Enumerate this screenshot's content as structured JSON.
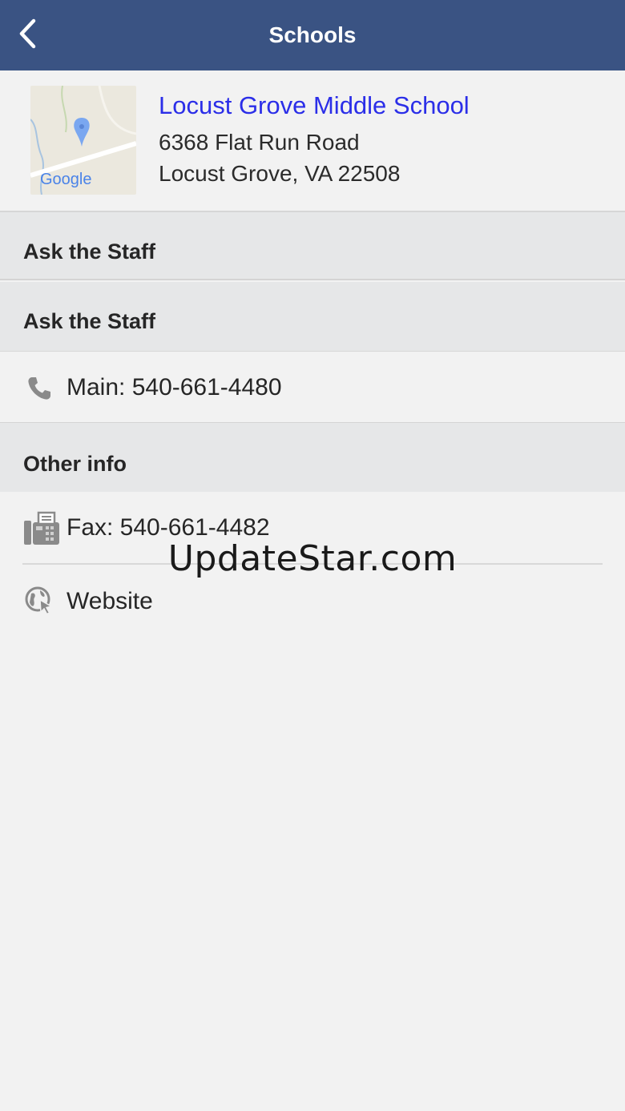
{
  "navbar": {
    "title": "Schools"
  },
  "school": {
    "name": "Locust Grove Middle School",
    "address_line1": "6368 Flat Run Road",
    "address_line2": "Locust Grove, VA 22508",
    "map_logo": "Google"
  },
  "sections": [
    {
      "header": "Ask the Staff"
    },
    {
      "header": "Ask the Staff"
    },
    {
      "header": "Other info"
    }
  ],
  "rows": {
    "main_phone": "Main: 540-661-4480",
    "fax": "Fax: 540-661-4482",
    "website": "Website"
  },
  "icons": {
    "back": "chevron-left-icon",
    "phone": "phone-icon",
    "fax": "fax-icon",
    "website": "globe-cursor-icon",
    "map_pin": "map-pin-icon"
  },
  "watermark": "UpdateStar.com",
  "colors": {
    "navbar": "#3a5383",
    "link": "#2b2ee8",
    "section_bg": "#e6e7e8",
    "page_bg": "#f2f2f2"
  }
}
